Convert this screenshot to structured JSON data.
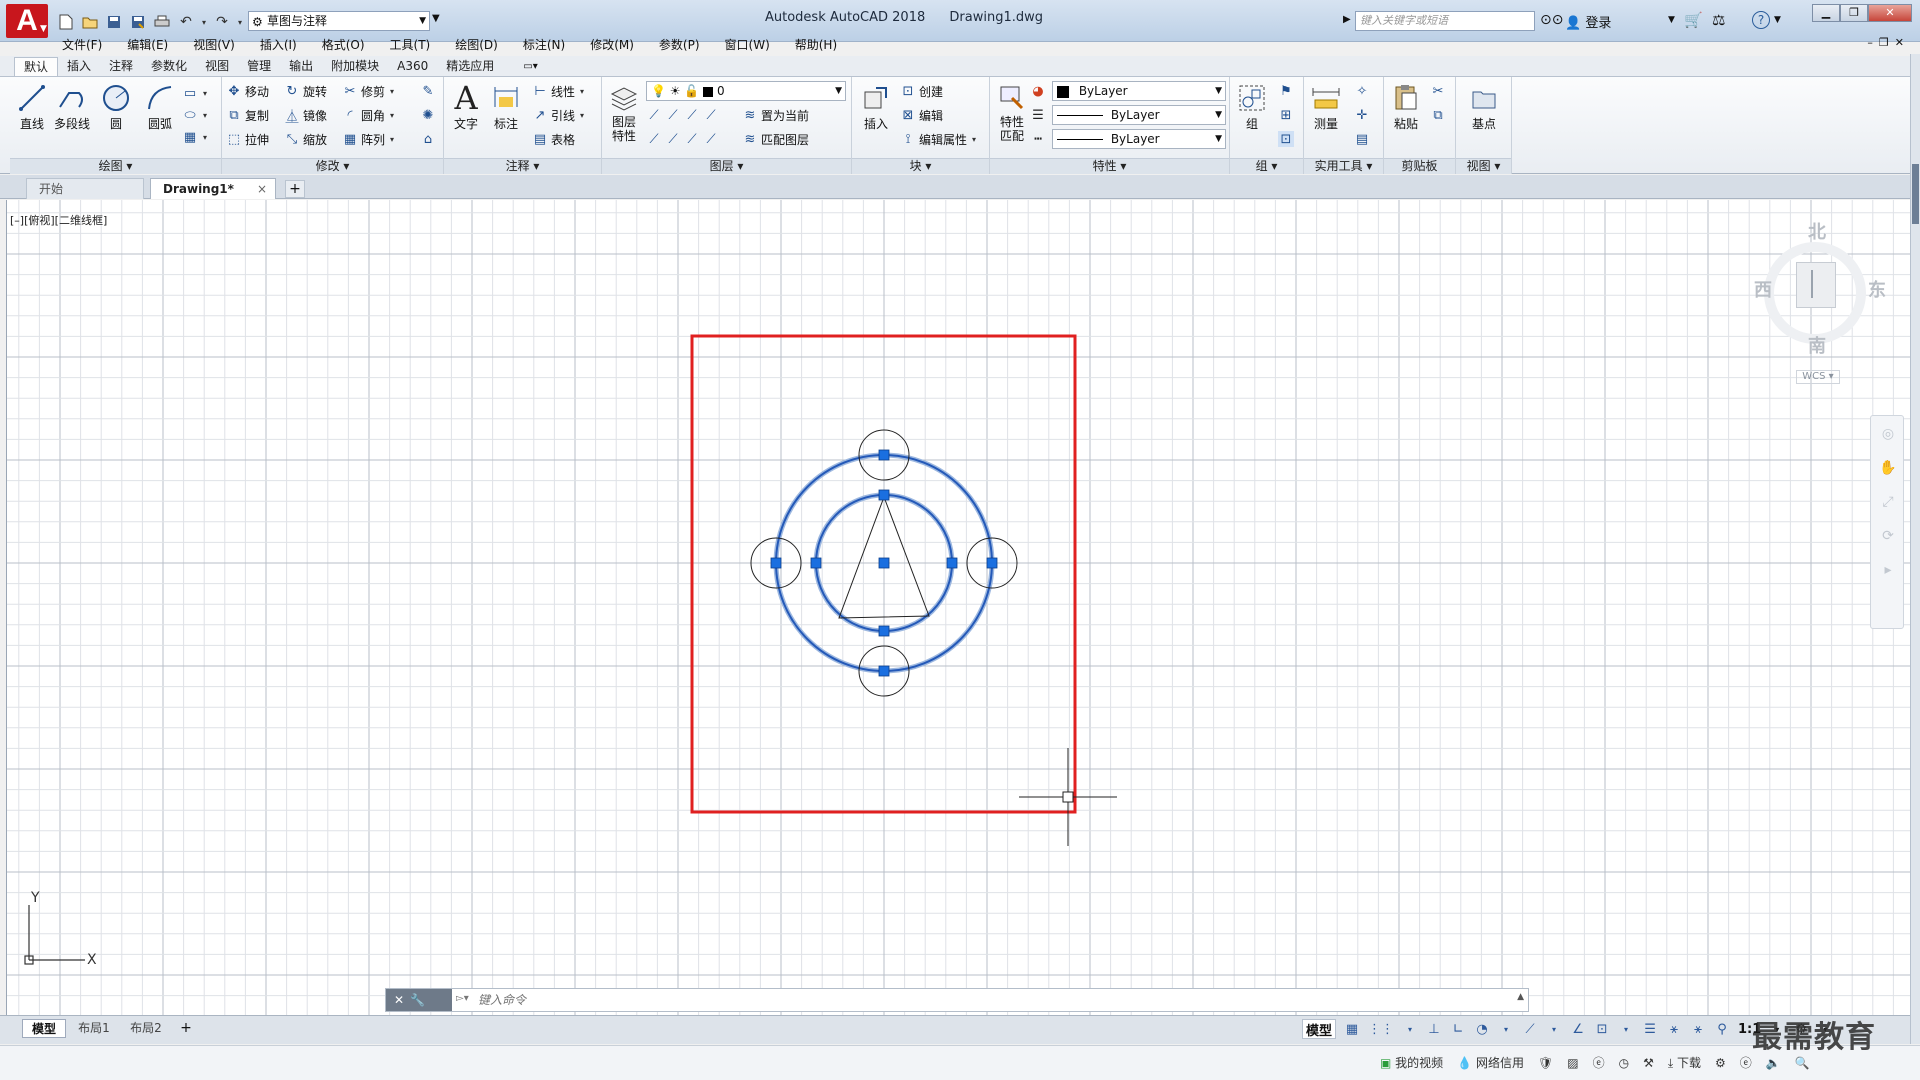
{
  "titlebar": {
    "app_name": "Autodesk AutoCAD 2018",
    "file_name": "Drawing1.dwg",
    "workspace": "草图与注释",
    "search_placeholder": "键入关键字或短语",
    "login_label": "登录",
    "logo_letter": "A"
  },
  "menubar": {
    "items": [
      "文件(F)",
      "编辑(E)",
      "视图(V)",
      "插入(I)",
      "格式(O)",
      "工具(T)",
      "绘图(D)",
      "标注(N)",
      "修改(M)",
      "参数(P)",
      "窗口(W)",
      "帮助(H)"
    ]
  },
  "ribbon_tabs": [
    "默认",
    "插入",
    "注释",
    "参数化",
    "视图",
    "管理",
    "输出",
    "附加模块",
    "A360",
    "精选应用"
  ],
  "ribbon": {
    "draw": {
      "title": "绘图",
      "tools": [
        "直线",
        "多段线",
        "圆",
        "圆弧"
      ]
    },
    "modify": {
      "title": "修改",
      "tools": [
        "移动",
        "旋转",
        "修剪",
        "复制",
        "镜像",
        "圆角",
        "拉伸",
        "缩放",
        "阵列"
      ]
    },
    "annotation": {
      "title": "注释",
      "big_tools": [
        "文字",
        "标注"
      ],
      "tools": [
        "线性",
        "引线",
        "表格"
      ]
    },
    "layers": {
      "title": "图层",
      "big_tool": "图层\n特性",
      "current_layer": "0",
      "tools": [
        "置为当前",
        "匹配图层"
      ]
    },
    "block": {
      "title": "块",
      "big_tool": "插入",
      "tools": [
        "创建",
        "编辑",
        "编辑属性"
      ]
    },
    "properties": {
      "title": "特性",
      "big_tool": "特性\n匹配",
      "color": "ByLayer",
      "linetype": "ByLayer",
      "lineweight": "ByLayer"
    },
    "groups": {
      "title": "组",
      "big_tool": "组"
    },
    "utilities": {
      "title": "实用工具",
      "big_tool": "测量"
    },
    "clipboard": {
      "title": "剪贴板",
      "big_tool": "粘贴"
    },
    "view": {
      "title": "视图",
      "big_tool": "基点"
    }
  },
  "file_tabs": {
    "start": "开始",
    "drawing": "Drawing1*"
  },
  "viewport_label": "[–][俯视][二维线框]",
  "viewcube": {
    "north": "北",
    "south": "南",
    "east": "东",
    "west": "西",
    "wcs": "WCS"
  },
  "ucs": {
    "x": "X",
    "y": "Y"
  },
  "cmdline": {
    "placeholder": "键入命令"
  },
  "layout_tabs": [
    "模型",
    "布局1",
    "布局2"
  ],
  "statusbar": {
    "model": "模型",
    "scale": "1:1"
  },
  "osbar": {
    "items": [
      "我的视频",
      "网络信用",
      "下载"
    ]
  },
  "watermark": "最需教育",
  "colors": {
    "selection_box": "#e02020",
    "grip": "#1a6fe0",
    "selected_circle": "#2459b8",
    "grid_minor": "#dfe2e7",
    "grid_major": "#b9bfc8"
  }
}
